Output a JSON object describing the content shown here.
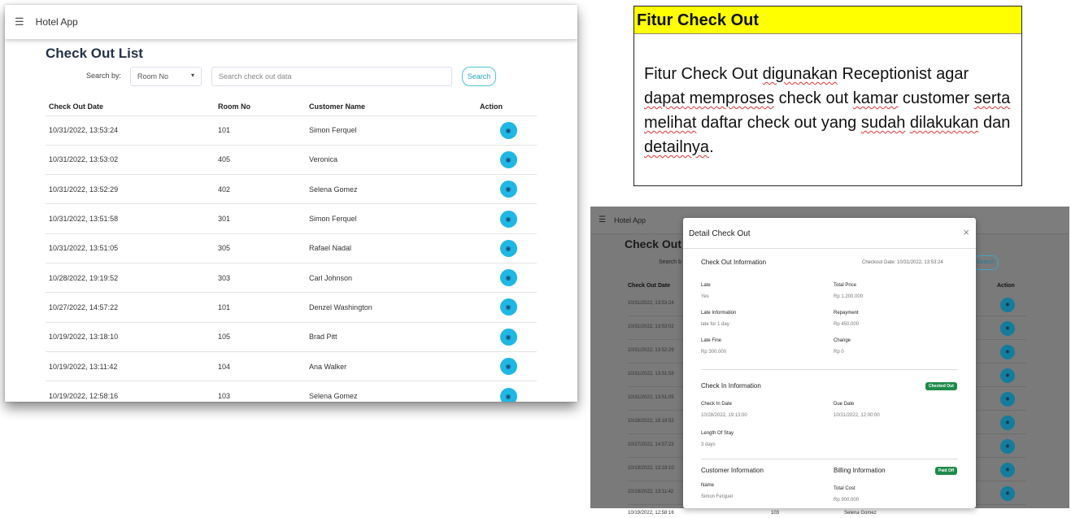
{
  "main": {
    "app_title": "Hotel App",
    "page_title": "Check Out List",
    "search_by_label": "Search by:",
    "search_by_value": "Room No",
    "search_placeholder": "Search check out data",
    "search_button": "Search",
    "columns": [
      "Check Out Date",
      "Room No",
      "Customer Name",
      "Action"
    ],
    "rows": [
      {
        "date": "10/31/2022, 13:53:24",
        "room": "101",
        "name": "Simon Ferquel"
      },
      {
        "date": "10/31/2022, 13:53:02",
        "room": "405",
        "name": "Veronica"
      },
      {
        "date": "10/31/2022, 13:52:29",
        "room": "402",
        "name": "Selena Gomez"
      },
      {
        "date": "10/31/2022, 13:51:58",
        "room": "301",
        "name": "Simon Ferquel"
      },
      {
        "date": "10/31/2022, 13:51:05",
        "room": "305",
        "name": "Rafael Nadal"
      },
      {
        "date": "10/28/2022, 19:19:52",
        "room": "303",
        "name": "Carl Johnson"
      },
      {
        "date": "10/27/2022, 14:57:22",
        "room": "101",
        "name": "Denzel Washington"
      },
      {
        "date": "10/19/2022, 13:18:10",
        "room": "105",
        "name": "Brad Pitt"
      },
      {
        "date": "10/19/2022, 13:11:42",
        "room": "104",
        "name": "Ana Walker"
      },
      {
        "date": "10/19/2022, 12:58:16",
        "room": "103",
        "name": "Selena Gomez"
      }
    ],
    "action_icon": "eye-icon",
    "accent_color": "#1fb7e3"
  },
  "feature": {
    "title": "Fitur Check Out",
    "text_segments": [
      "Fitur Check Out ",
      "digunakan",
      " Receptionist agar ",
      "dapat memproses",
      " check out ",
      "kamar",
      " customer ",
      "serta melihat",
      "  daftar check out yang ",
      "sudah",
      " ",
      "dilakukan",
      "  dan ",
      "detailnya",
      "."
    ],
    "title_bg": "#ffff00"
  },
  "modal_shot": {
    "app_title": "Hotel App",
    "page_title": "Check Out Li",
    "search_by": "Search b",
    "search_button": "Search",
    "col_date": "Check Out Date",
    "col_action": "Action",
    "bg_dates": [
      "10/31/2022, 13:53:24",
      "10/31/2022, 13:53:02",
      "10/31/2022, 13:52:29",
      "10/31/2022, 13:51:58",
      "10/31/2022, 13:51:05",
      "10/28/2022, 19:19:52",
      "10/27/2022, 14:57:22",
      "10/19/2022, 13:18:10",
      "10/19/2022, 13:11:42"
    ],
    "last_row": {
      "date": "10/19/2022, 12:58:16",
      "room": "103",
      "name": "Selena Gomez"
    },
    "modal": {
      "title": "Detail Check Out",
      "checkout_info": "Check Out Information",
      "checkout_date": "Checkout Date: 10/31/2022, 13:53:24",
      "late_label": "Late",
      "late_value": "Yes",
      "late_info_label": "Late Information",
      "late_info_value": "late for 1 day",
      "late_fine_label": "Late Fine",
      "late_fine_value": "Rp 300.000",
      "total_price_label": "Total Price",
      "total_price_value": "Rp 1.200.000",
      "repayment_label": "Repayment",
      "repayment_value": "Rp 450.000",
      "change_label": "Change",
      "change_value": "Rp 0",
      "checkin_info": "Check In Information",
      "checked_out_badge": "Checked Out",
      "checkin_date_label": "Check In Date",
      "checkin_date_value": "10/28/2022, 19:13:00",
      "due_date_label": "Due Date",
      "due_date_value": "10/31/2022, 12:00:00",
      "length_label": "Length Of Stay",
      "length_value": "3 days",
      "customer_info": "Customer Information",
      "billing_info": "Billing Information",
      "paid_badge": "Paid Off",
      "name_label": "Name",
      "name_value": "Simon Ferquel",
      "total_cost_label": "Total Cost",
      "total_cost_value": "Rp 900.000"
    }
  }
}
